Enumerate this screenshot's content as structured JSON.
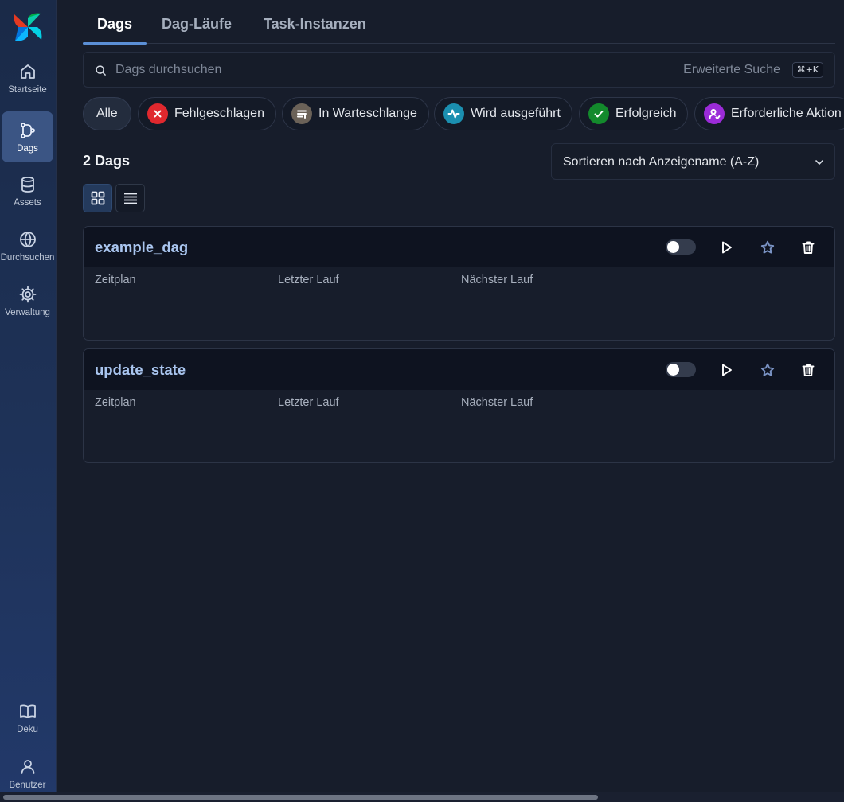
{
  "sidebar": {
    "items": [
      {
        "label": "Startseite",
        "icon": "home-icon"
      },
      {
        "label": "Dags",
        "icon": "dag-icon",
        "active": true
      },
      {
        "label": "Assets",
        "icon": "database-icon"
      },
      {
        "label": "Durchsuchen",
        "icon": "globe-icon"
      },
      {
        "label": "Verwaltung",
        "icon": "gear-icon"
      }
    ],
    "bottom_items": [
      {
        "label": "Deku",
        "icon": "book-icon"
      },
      {
        "label": "Benutzer",
        "icon": "user-icon"
      }
    ]
  },
  "tabs": [
    "Dags",
    "Dag-Läufe",
    "Task-Instanzen"
  ],
  "search": {
    "placeholder": "Dags durchsuchen",
    "value": "",
    "advanced_label": "Erweiterte Suche",
    "shortcut": "⌘+K"
  },
  "filters": [
    {
      "label": "Alle",
      "active": true
    },
    {
      "label": "Fehlgeschlagen",
      "icon": "x-icon",
      "color": "#e0282e"
    },
    {
      "label": "In Warteschlange",
      "icon": "queue-icon",
      "color": "#6b6258"
    },
    {
      "label": "Wird ausgeführt",
      "icon": "activity-icon",
      "color": "#1b8fb0"
    },
    {
      "label": "Erfolgreich",
      "icon": "check-icon",
      "color": "#138a2c"
    },
    {
      "label": "Erforderliche Aktion",
      "icon": "user-action-icon",
      "color": "#9b2bd8"
    }
  ],
  "dag_count": "2 Dags",
  "sort": {
    "label": "Sortieren nach Anzeigename (A-Z)"
  },
  "dags": [
    {
      "name": "example_dag",
      "schedule_label": "Zeitplan",
      "last_run_label": "Letzter Lauf",
      "next_run_label": "Nächster Lauf",
      "paused": true
    },
    {
      "name": "update_state",
      "schedule_label": "Zeitplan",
      "last_run_label": "Letzter Lauf",
      "next_run_label": "Nächster Lauf",
      "paused": true
    }
  ],
  "colors": {
    "accent": "#5b8fd6",
    "dag_title": "#a9c5ef",
    "background": "#171d2b"
  }
}
